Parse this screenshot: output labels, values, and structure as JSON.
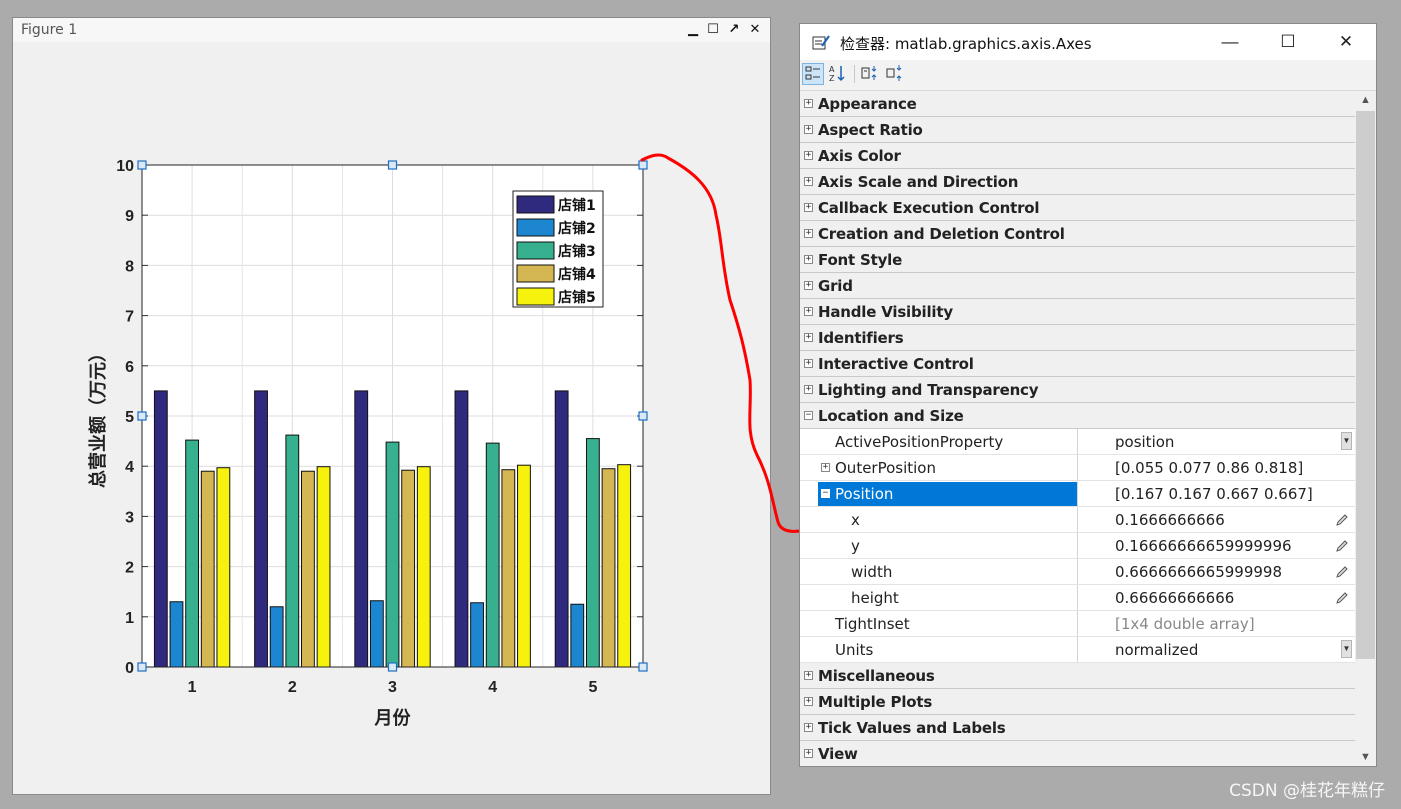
{
  "figure": {
    "title": "Figure 1",
    "controls": [
      "minimize-icon",
      "maximize-icon",
      "undock-icon",
      "close-icon"
    ]
  },
  "chart_data": {
    "type": "bar",
    "categories": [
      "1",
      "2",
      "3",
      "4",
      "5"
    ],
    "series": [
      {
        "name": "店铺1",
        "color": "#2f2a7e",
        "values": [
          5.5,
          5.5,
          5.5,
          5.5,
          5.5
        ]
      },
      {
        "name": "店铺2",
        "color": "#1c86d0",
        "values": [
          1.3,
          1.2,
          1.32,
          1.28,
          1.25
        ]
      },
      {
        "name": "店铺3",
        "color": "#36b08e",
        "values": [
          4.52,
          4.62,
          4.48,
          4.46,
          4.55
        ]
      },
      {
        "name": "店铺4",
        "color": "#d4b652",
        "values": [
          3.9,
          3.9,
          3.92,
          3.93,
          3.95
        ]
      },
      {
        "name": "店铺5",
        "color": "#f6f20d",
        "values": [
          3.97,
          3.99,
          3.99,
          4.02,
          4.03
        ]
      }
    ],
    "xlabel": "月份",
    "ylabel": "总营业额（万元）",
    "ylim": [
      0,
      10
    ],
    "yticks": [
      "0",
      "1",
      "2",
      "3",
      "4",
      "5",
      "6",
      "7",
      "8",
      "9",
      "10"
    ],
    "grid": true,
    "legend_position": "top-right"
  },
  "inspector": {
    "title": "检查器:  matlab.graphics.axis.Axes",
    "window_controls": [
      "minimize-icon",
      "maximize-icon",
      "close-icon"
    ],
    "toolbar": [
      "categorized-icon",
      "sort-alpha-icon",
      "expand-all-icon",
      "collapse-all-icon"
    ],
    "categories_top": [
      "Appearance",
      "Aspect Ratio",
      "Axis Color",
      "Axis Scale and Direction",
      "Callback Execution Control",
      "Creation and Deletion Control",
      "Font Style",
      "Grid",
      "Handle Visibility",
      "Identifiers",
      "Interactive Control",
      "Lighting and Transparency"
    ],
    "expanded_category": "Location and Size",
    "properties": [
      {
        "name": "ActivePositionProperty",
        "value": "position",
        "dropdown": true
      },
      {
        "name": "OuterPosition",
        "value": "[0.055 0.077 0.86 0.818]",
        "expandable": true
      },
      {
        "name": "Position",
        "value": "[0.167 0.167 0.667 0.667]",
        "expanded": true,
        "selected": true
      },
      {
        "name": "x",
        "value": "0.1666666666",
        "editable": true
      },
      {
        "name": "y",
        "value": "0.16666666659999996",
        "editable": true
      },
      {
        "name": "width",
        "value": "0.6666666665999998",
        "editable": true
      },
      {
        "name": "height",
        "value": "0.66666666666",
        "editable": true
      },
      {
        "name": "TightInset",
        "value": "[1x4  double array]",
        "dim": true
      },
      {
        "name": "Units",
        "value": "normalized",
        "dropdown": true
      }
    ],
    "categories_bottom": [
      "Miscellaneous",
      "Multiple Plots",
      "Tick Values and Labels",
      "View"
    ]
  },
  "watermark": "CSDN @桂花年糕仔",
  "colors": {
    "selection": "#0078d7",
    "annotation": "#ff0000"
  }
}
